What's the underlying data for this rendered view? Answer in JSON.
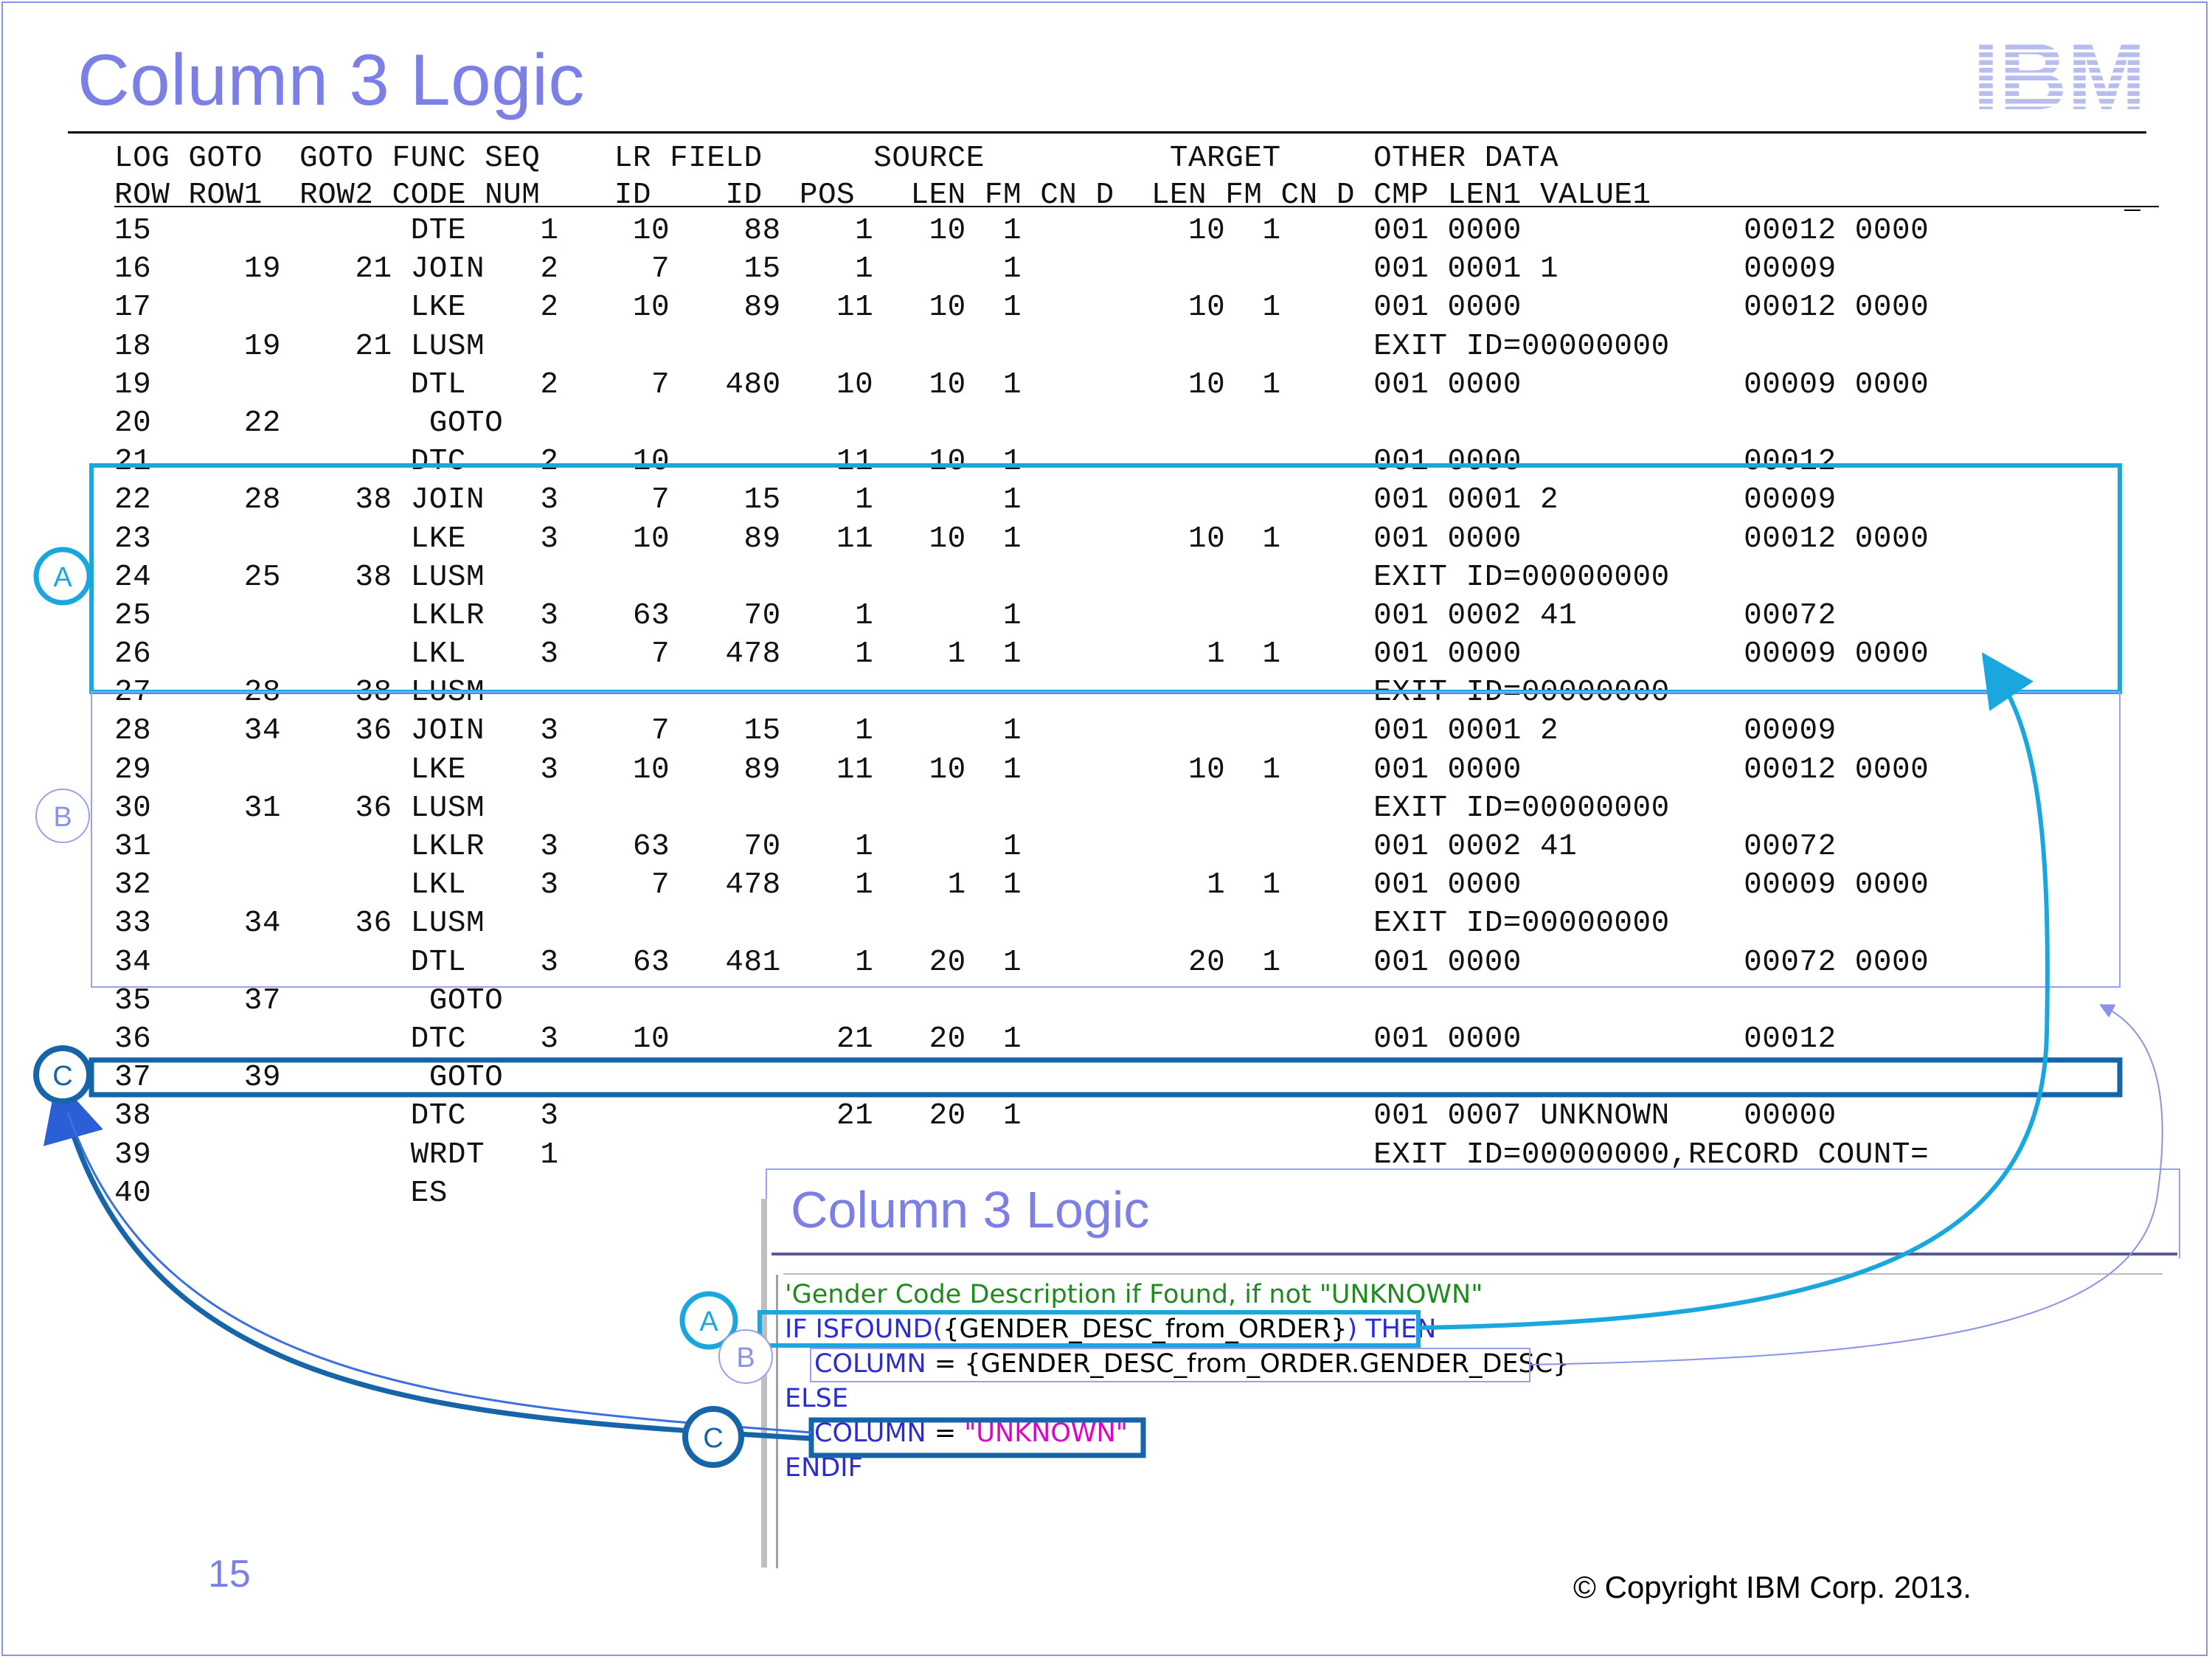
{
  "slide": {
    "title": "Column 3 Logic",
    "logo_text": "IBM",
    "page_number": "15",
    "copyright": "© Copyright IBM Corp. 2013."
  },
  "table": {
    "header_line1": "LOG GOTO  GOTO FUNC SEQ    LR FIELD      SOURCE          TARGET     OTHER DATA",
    "header_line2": "ROW ROW1  ROW2 CODE NUM    ID    ID  POS   LEN FM CN D  LEN FM CN D CMP LEN1 VALUE1",
    "rows": [
      "15              DTE    1    10    88    1   10  1         10  1     001 0000            00012 0000",
      "16     19    21 JOIN   2     7    15    1       1                   001 0001 1          00009",
      "17              LKE    2    10    89   11   10  1         10  1     001 0000            00012 0000",
      "18     19    21 LUSM                                                EXIT ID=00000000",
      "19              DTL    2     7   480   10   10  1         10  1     001 0000            00009 0000",
      "20     22        GOTO",
      "21              DTC    2    10         11   10  1                   001 0000            00012",
      "22     28    38 JOIN   3     7    15    1       1                   001 0001 2          00009",
      "23              LKE    3    10    89   11   10  1         10  1     001 0000            00012 0000",
      "24     25    38 LUSM                                                EXIT ID=00000000",
      "25              LKLR   3    63    70    1       1                   001 0002 41         00072",
      "26              LKL    3     7   478    1    1  1          1  1     001 0000            00009 0000",
      "27     28    38 LUSM                                                EXIT ID=00000000",
      "28     34    36 JOIN   3     7    15    1       1                   001 0001 2          00009",
      "29              LKE    3    10    89   11   10  1         10  1     001 0000            00012 0000",
      "30     31    36 LUSM                                                EXIT ID=00000000",
      "31              LKLR   3    63    70    1       1                   001 0002 41         00072",
      "32              LKL    3     7   478    1    1  1          1  1     001 0000            00009 0000",
      "33     34    36 LUSM                                                EXIT ID=00000000",
      "34              DTL    3    63   481    1   20  1         20  1     001 0000            00072 0000",
      "35     37        GOTO",
      "36              DTC    3    10         21   20  1                   001 0000            00012",
      "37     39        GOTO",
      "38              DTC    3               21   20  1                   001 0007 UNKNOWN    00000",
      "39              WRDT   1                                            EXIT ID=00000000,RECORD COUNT=",
      "40              ES"
    ]
  },
  "callouts": {
    "a": "A",
    "b": "B",
    "c": "C"
  },
  "inset": {
    "title": "Column 3 Logic",
    "comment": "'Gender Code Description if Found, if not \"UNKNOWN\"",
    "line_if_kw1": "IF ISFOUND(",
    "line_if_fld": "{GENDER_DESC_from_ORDER}",
    "line_if_kw2": ") THEN",
    "line_col1_kw": "COLUMN",
    "line_col1_eq": " = ",
    "line_col1_fld": "{GENDER_DESC_from_ORDER.GENDER_DESC}",
    "line_else": "ELSE",
    "line_col2_kw": "COLUMN",
    "line_col2_eq": " = ",
    "line_col2_str": "\"UNKNOWN\"",
    "line_endif": "ENDIF"
  },
  "colors": {
    "accent_light_blue": "#1aa7e0",
    "accent_periwinkle": "#8b93e8",
    "accent_dark_blue": "#1565a8",
    "title": "#7b7fe6"
  }
}
